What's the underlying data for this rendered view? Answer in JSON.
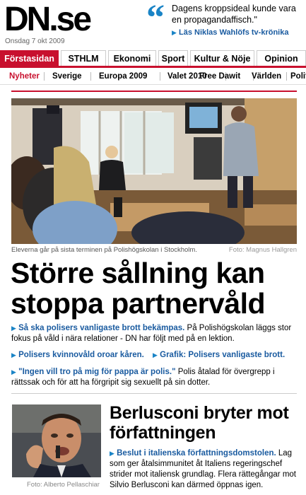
{
  "header": {
    "logo": "DN.se",
    "date": "Onsdag 7 okt 2009",
    "promo_line1": "Dagens kroppsideal kunde vara en propagandaffisch.\"",
    "promo_link": "Läs Niklas Wahlöfs tv-krönika"
  },
  "main_nav": [
    "Förstasidan",
    "STHLM",
    "Ekonomi",
    "Sport",
    "Kultur & Nöje",
    "Opinion"
  ],
  "sub_nav": [
    "Nyheter",
    "Sverige",
    "Europa 2009",
    "Valet 2010",
    "Free Dawit",
    "Världen",
    "Polit"
  ],
  "story1": {
    "caption": "Eleverna går på sista terminen på Polishögskolan i Stockholm.",
    "credit": "Foto: Magnus Hallgren",
    "headline": "Större sållning kan stoppa partnervåld",
    "link1": "Så ska polisers vanligaste brott bekämpas.",
    "intro_text": "På Polishögskolan läggs stor fokus på våld i nära relationer - DN har följt med på en lektion.",
    "link2": "Polisers kvinnovåld oroar kåren.",
    "link3": "Grafik: Polisers vanligaste brott.",
    "link4": "\"Ingen vill tro på mig för pappa är polis.\"",
    "text4": "Polis åtalad för övergrepp i rättssak och för att ha förgripit sig sexuellt på sin dotter."
  },
  "story2": {
    "credit": "Foto: Alberto Pellaschiar",
    "headline": "Berlusconi bryter mot författningen",
    "link": "Beslut i italienska författningsdomstolen.",
    "text": "Lag som ger åtalsimmunitet åt Italiens regeringschef strider mot italiensk grundlag. Flera rättegångar mot Silvio Berlusconi kan därmed öppnas igen."
  },
  "colors": {
    "accent_red": "#c8102e",
    "link_blue": "#1a5ba0",
    "bullet_blue": "#1a84c6"
  }
}
